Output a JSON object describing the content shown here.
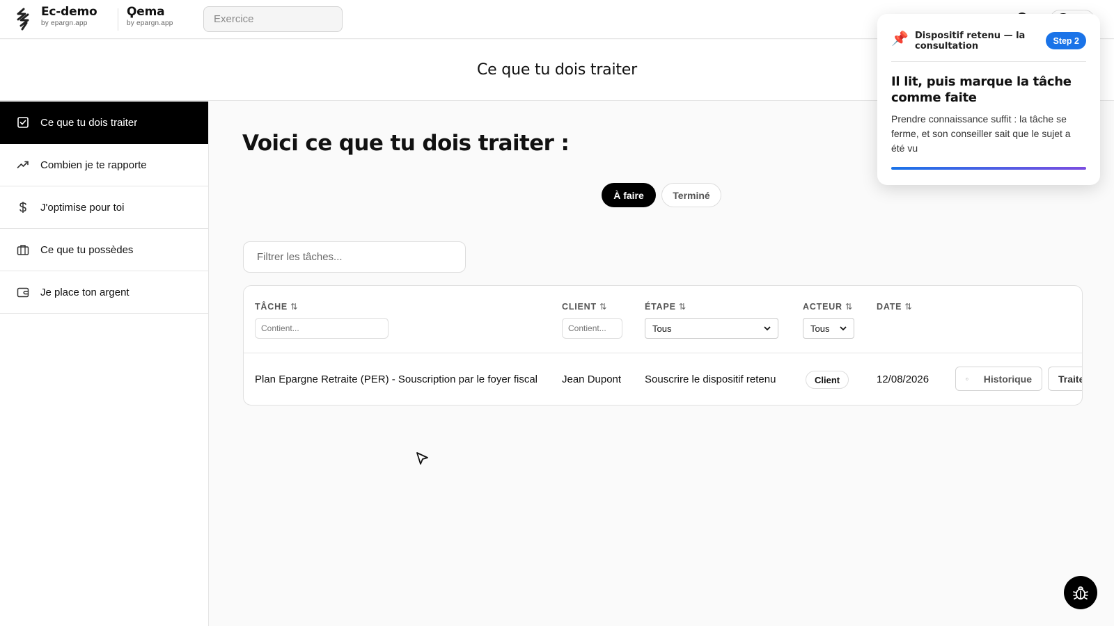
{
  "topbar": {
    "brand1_name": "Ec-demo",
    "brand1_sub": "by epargn.app",
    "brand2_name": "Ϙema",
    "brand2_sub": "by epargn.app",
    "exercice_placeholder": "Exercice"
  },
  "page_header": {
    "title": "Ce que tu dois traiter"
  },
  "sidebar": {
    "items": [
      {
        "label": "Ce que tu dois traiter",
        "icon": "check-square-icon",
        "active": true
      },
      {
        "label": "Combien je te rapporte",
        "icon": "trending-up-icon"
      },
      {
        "label": "J'optimise pour toi",
        "icon": "dollar-icon"
      },
      {
        "label": "Ce que tu possèdes",
        "icon": "briefcase-icon"
      },
      {
        "label": "Je place ton argent",
        "icon": "wallet-icon"
      }
    ]
  },
  "main": {
    "title": "Voici ce que tu dois traiter :",
    "tabs": {
      "todo": "À faire",
      "done": "Terminé"
    },
    "filter_placeholder": "Filtrer les tâches..."
  },
  "table": {
    "columns": {
      "task": "TÂCHE",
      "client": "CLIENT",
      "step": "ÉTAPE",
      "actor": "ACTEUR",
      "date": "DATE"
    },
    "sort_glyph": "⇅",
    "filters": {
      "task_placeholder": "Contient...",
      "client_placeholder": "Contient...",
      "step_value": "Tous",
      "actor_value": "Tous"
    },
    "rows": [
      {
        "task": "Plan Epargne Retraite (PER) - Souscription par le foyer fiscal",
        "client": "Jean Dupont",
        "step": "Souscrire le dispositif retenu",
        "actor": "Client",
        "date": "12/08/2026",
        "history_label": "Historique",
        "action_label": "Traiter"
      }
    ]
  },
  "tour": {
    "kicker": "Dispositif retenu — la consultation",
    "step_label": "Step 2",
    "title": "Il lit, puis marque la tâche comme faite",
    "body": "Prendre connaissance suffit : la tâche se ferme, et son conseiller sait que le sujet a été vu",
    "progress": 1.0
  },
  "colors": {
    "accent": "#1a73e8",
    "progress_end": "#7b4de0",
    "active_bg": "#000000"
  }
}
